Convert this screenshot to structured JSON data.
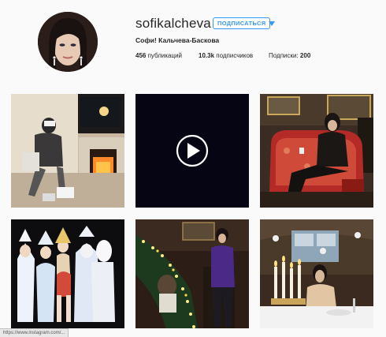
{
  "profile": {
    "username": "sofikalcheva",
    "follow_label": "ПОДПИСАТЬСЯ",
    "full_name": "Софи! Кальчева-Баскова",
    "stats": {
      "posts_count": "456",
      "posts_label": "публикаций",
      "followers_count": "10.3k",
      "followers_label": "подписчиков",
      "following_label": "Подписки:",
      "following_count": "200"
    }
  },
  "posts": [
    {
      "kind": "photo",
      "subject": "woman-with-vr-headset-by-fireplace"
    },
    {
      "kind": "video",
      "subject": "dark-video-play"
    },
    {
      "kind": "photo",
      "subject": "woman-in-red-armchair"
    },
    {
      "kind": "photo",
      "subject": "snow-maiden-group"
    },
    {
      "kind": "photo",
      "subject": "woman-by-christmas-garland-stairs"
    },
    {
      "kind": "photo",
      "subject": "woman-with-candles-dinner"
    }
  ],
  "status_bar": {
    "url": "https://www.instagram.com/..."
  },
  "colors": {
    "accent": "#3897f0",
    "background": "#fafafa",
    "text": "#262626"
  }
}
